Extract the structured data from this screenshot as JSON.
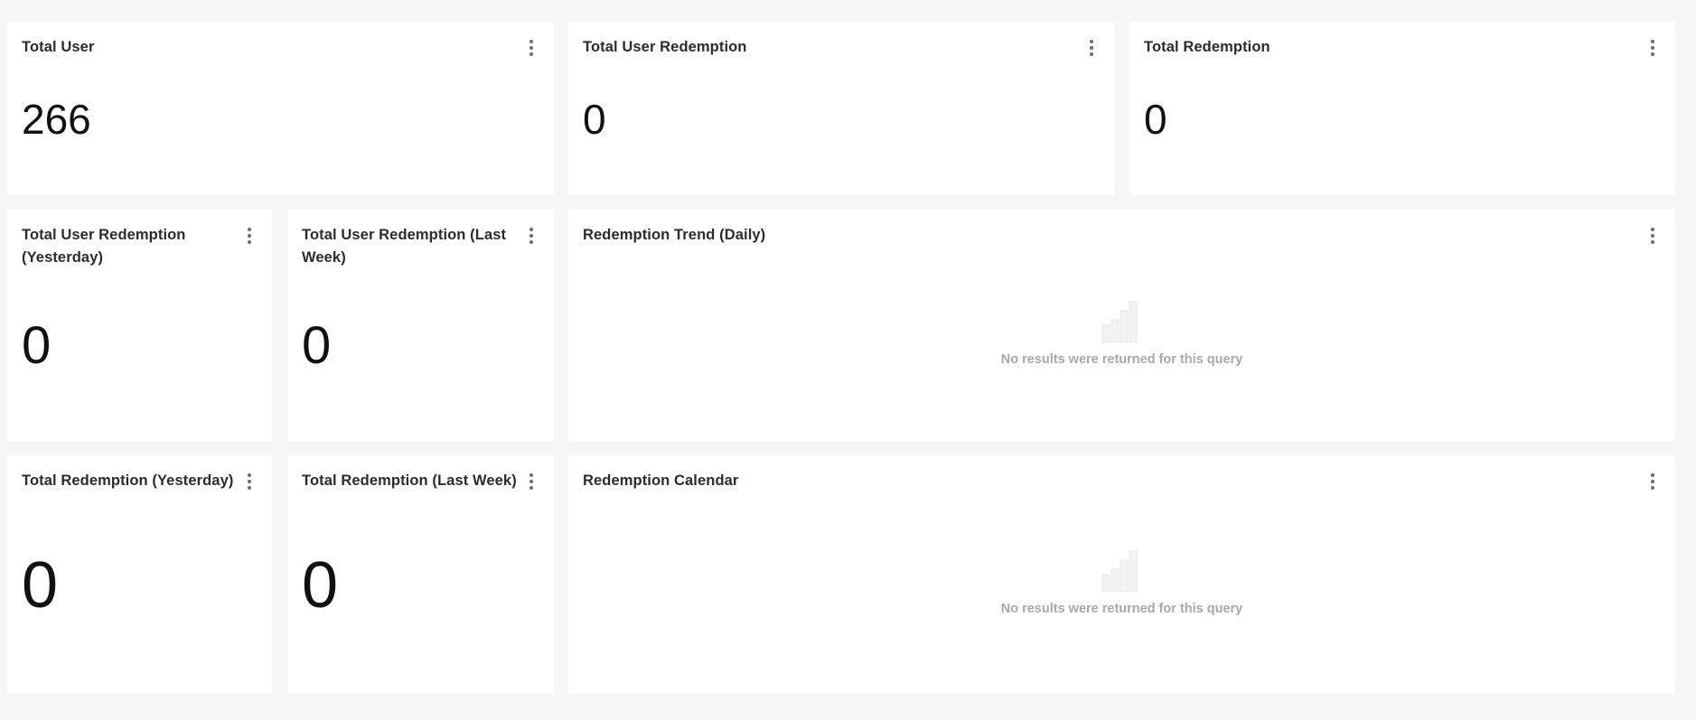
{
  "cards": {
    "total_user": {
      "title": "Total User",
      "value": "266"
    },
    "total_user_redemption": {
      "title": "Total User Redemption",
      "value": "0"
    },
    "total_redemption": {
      "title": "Total Redemption",
      "value": "0"
    },
    "total_user_redemption_yesterday": {
      "title": "Total User Redemption (Yesterday)",
      "value": "0"
    },
    "total_user_redemption_last_week": {
      "title": "Total User Redemption (Last Week)",
      "value": "0"
    },
    "redemption_trend_daily": {
      "title": "Redemption Trend (Daily)",
      "empty_message": "No results were returned for this query"
    },
    "total_redemption_yesterday": {
      "title": "Total Redemption (Yesterday)",
      "value": "0"
    },
    "total_redemption_last_week": {
      "title": "Total Redemption (Last Week)",
      "value": "0"
    },
    "redemption_calendar": {
      "title": "Redemption Calendar",
      "empty_message": "No results were returned for this query"
    }
  },
  "icons": {
    "card_menu": "more-vertical-icon",
    "empty_state": "bar-chart-icon"
  },
  "colors": {
    "background": "#f6f6f6",
    "card": "#ffffff",
    "title_text": "#2c2c2c",
    "metric_text": "#111111",
    "muted_text": "#a8a8a8"
  }
}
